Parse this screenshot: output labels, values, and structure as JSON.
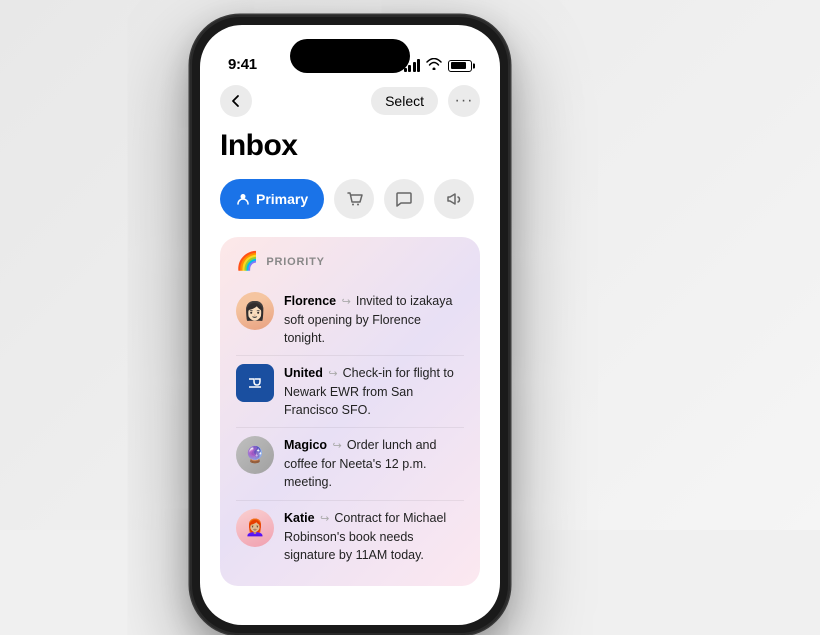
{
  "scene": {
    "background": "#f0f0f0"
  },
  "statusBar": {
    "time": "9:41"
  },
  "navBar": {
    "selectLabel": "Select",
    "moreLabel": "···"
  },
  "header": {
    "title": "Inbox"
  },
  "filterTabs": [
    {
      "id": "primary",
      "label": "Primary",
      "active": true
    },
    {
      "id": "shopping",
      "label": "Shopping",
      "active": false
    },
    {
      "id": "chat",
      "label": "Chat",
      "active": false
    },
    {
      "id": "promotions",
      "label": "Promotions",
      "active": false
    }
  ],
  "prioritySection": {
    "label": "PRIORITY",
    "emails": [
      {
        "id": 1,
        "sender": "Florence",
        "preview": "Invited to izakaya soft opening by Florence tonight.",
        "avatarType": "florence"
      },
      {
        "id": 2,
        "sender": "United",
        "preview": "Check-in for flight to Newark EWR from San Francisco SFO.",
        "avatarType": "united"
      },
      {
        "id": 3,
        "sender": "Magico",
        "preview": "Order lunch and coffee for Neeta's 12 p.m. meeting.",
        "avatarType": "magico"
      },
      {
        "id": 4,
        "sender": "Katie",
        "preview": "Contract for Michael Robinson's book needs signature by 11AM today.",
        "avatarType": "katie"
      }
    ]
  }
}
